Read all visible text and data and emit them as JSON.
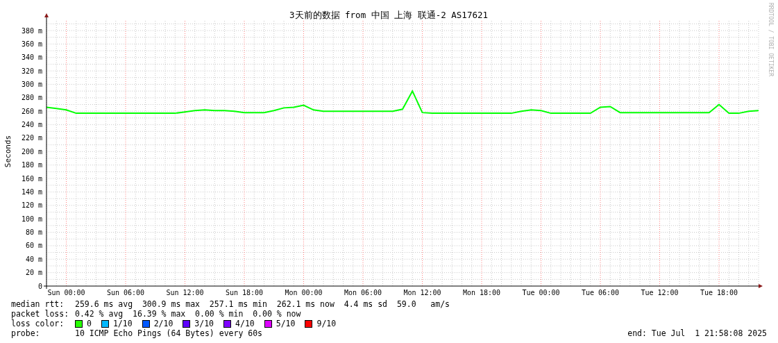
{
  "chart_data": {
    "type": "line",
    "title": "3天前的数据 from 中国 上海 联通-2 AS17621",
    "ylabel": "Seconds",
    "categories": [
      null,
      null,
      "Sun 00:00",
      null,
      null,
      null,
      null,
      null,
      "Sun 06:00",
      null,
      null,
      null,
      null,
      null,
      "Sun 12:00",
      null,
      null,
      null,
      null,
      null,
      "Sun 18:00",
      null,
      null,
      null,
      null,
      null,
      "Mon 00:00",
      null,
      null,
      null,
      null,
      null,
      "Mon 06:00",
      null,
      null,
      null,
      null,
      null,
      "Mon 12:00",
      null,
      null,
      null,
      null,
      null,
      "Mon 18:00",
      null,
      null,
      null,
      null,
      null,
      "Tue 00:00",
      null,
      null,
      null,
      null,
      null,
      "Tue 06:00",
      null,
      null,
      null,
      null,
      null,
      "Tue 12:00",
      null,
      null,
      null,
      null,
      null,
      "Tue 18:00",
      null,
      null,
      null,
      null
    ],
    "series": [
      {
        "color": "#00ff00",
        "values": [
          266,
          264,
          262,
          257,
          257,
          257,
          257,
          257,
          257,
          257,
          257,
          257,
          257,
          257,
          259,
          261,
          262,
          261,
          261,
          260,
          258,
          258,
          258,
          261,
          265,
          266,
          269,
          262,
          260,
          260,
          260,
          260,
          260,
          260,
          260,
          260,
          263,
          290,
          258,
          257,
          257,
          257,
          257,
          257,
          257,
          257,
          257,
          257,
          260,
          262,
          261,
          257,
          257,
          257,
          257,
          257,
          266,
          267,
          258,
          258,
          258,
          258,
          258,
          258,
          258,
          258,
          258,
          258,
          270,
          257,
          257,
          260,
          261
        ]
      }
    ],
    "ylim": [
      0,
      395
    ],
    "grid": true,
    "yticks": [
      {
        "value": 0,
        "label": "0"
      },
      {
        "value": 20,
        "label": "20 m"
      },
      {
        "value": 40,
        "label": "40 m"
      },
      {
        "value": 60,
        "label": "60 m"
      },
      {
        "value": 80,
        "label": "80 m"
      },
      {
        "value": 100,
        "label": "100 m"
      },
      {
        "value": 120,
        "label": "120 m"
      },
      {
        "value": 140,
        "label": "140 m"
      },
      {
        "value": 160,
        "label": "160 m"
      },
      {
        "value": 180,
        "label": "180 m"
      },
      {
        "value": 200,
        "label": "200 m"
      },
      {
        "value": 220,
        "label": "220 m"
      },
      {
        "value": 240,
        "label": "240 m"
      },
      {
        "value": 260,
        "label": "260 m"
      },
      {
        "value": 280,
        "label": "280 m"
      },
      {
        "value": 300,
        "label": "300 m"
      },
      {
        "value": 320,
        "label": "320 m"
      },
      {
        "value": 340,
        "label": "340 m"
      },
      {
        "value": 360,
        "label": "360 m"
      },
      {
        "value": 380,
        "label": "380 m"
      }
    ]
  },
  "credit": "RRDTOOL / TOBI OETIKER",
  "stats": [
    {
      "label": "median rtt:",
      "text": "259.6 ms avg  300.9 ms max  257.1 ms min  262.1 ms now  4.4 ms sd  59.0   am/s"
    },
    {
      "label": "packet loss:",
      "text": "0.42 % avg  16.39 % max  0.00 % min  0.00 % now"
    }
  ],
  "loss_color": {
    "label": "loss color:",
    "items": [
      {
        "label": "0",
        "color": "#26ff00"
      },
      {
        "label": "1/10",
        "color": "#00b8ff"
      },
      {
        "label": "2/10",
        "color": "#0059ff"
      },
      {
        "label": "3/10",
        "color": "#5e00ff"
      },
      {
        "label": "4/10",
        "color": "#7e00ff"
      },
      {
        "label": "5/10",
        "color": "#dd00ff"
      },
      {
        "label": "9/10",
        "color": "#ff0000"
      }
    ]
  },
  "probe": {
    "label": "probe:",
    "text": "10 ICMP Echo Pings (64 Bytes) every 60s"
  },
  "end": "end: Tue Jul  1 21:58:08 2025"
}
